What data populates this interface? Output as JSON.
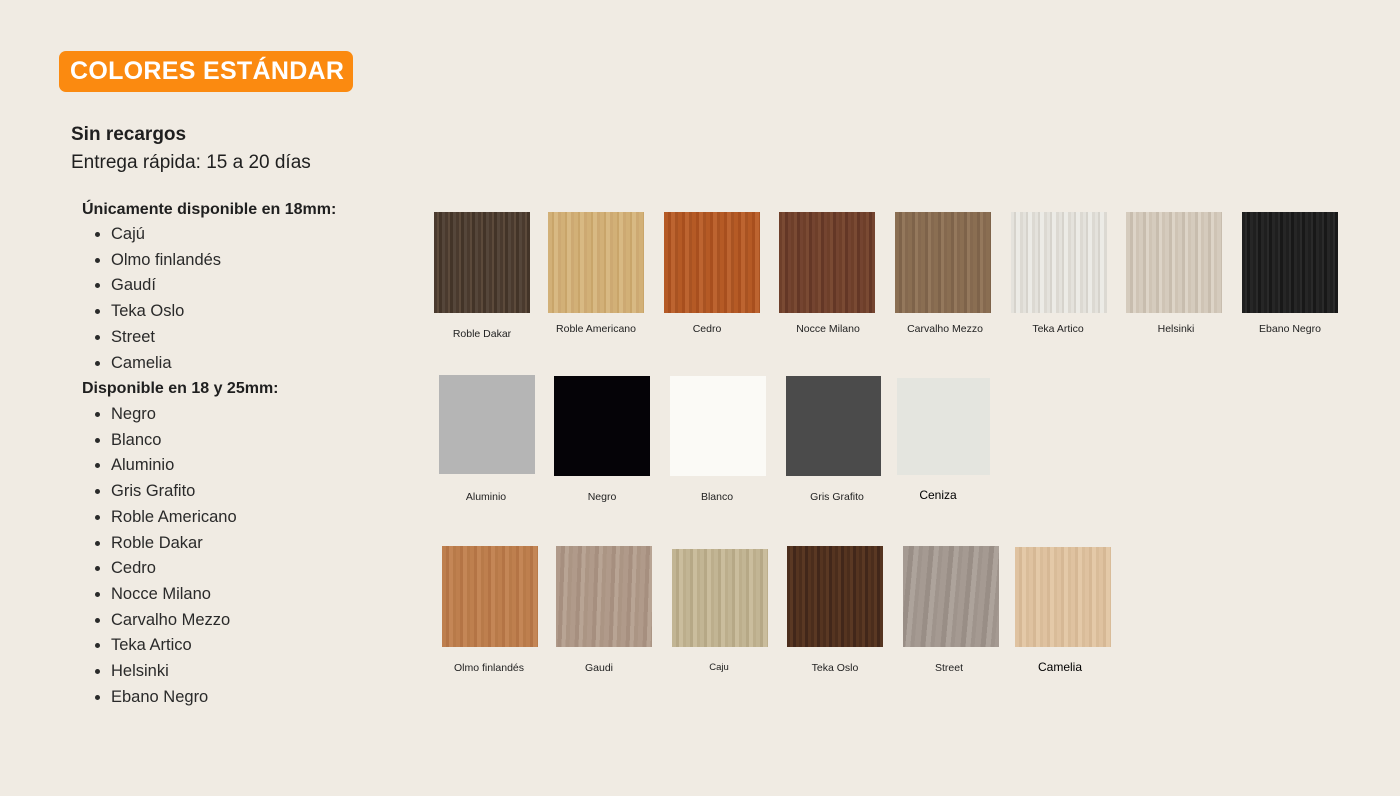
{
  "badge": "COLORES ESTÁNDAR",
  "subtitle_bold": "Sin recargos",
  "subtitle": "Entrega rápida: 15 a 20 días",
  "section18": {
    "title": "Únicamente disponible en 18mm:",
    "items": [
      "Cajú",
      "Olmo finlandés",
      "Gaudí",
      "Teka Oslo",
      "Street",
      "Camelia"
    ]
  },
  "section1825": {
    "title": "Disponible en 18 y 25mm:",
    "items": [
      "Negro",
      "Blanco",
      "Aluminio",
      "Gris Grafito",
      "Roble Americano",
      "Roble Dakar",
      "Cedro",
      "Nocce Milano",
      "Carvalho Mezzo",
      "Teka Artico",
      "Helsinki",
      "Ebano Negro"
    ]
  },
  "swatches": [
    "Roble Dakar",
    "Roble Americano",
    "Cedro",
    "Nocce Milano",
    "Carvalho Mezzo",
    "Teka Artico",
    "Helsinki",
    "Ebano Negro",
    "Aluminio",
    "Negro",
    "Blanco",
    "Gris Grafito",
    "Ceniza",
    "Olmo finlandés",
    "Gaudi",
    "Caju",
    "Teka Oslo",
    "Street",
    "Camelia"
  ],
  "colors": {
    "badge": "#fb8a10",
    "background": "#f0ebe3"
  }
}
